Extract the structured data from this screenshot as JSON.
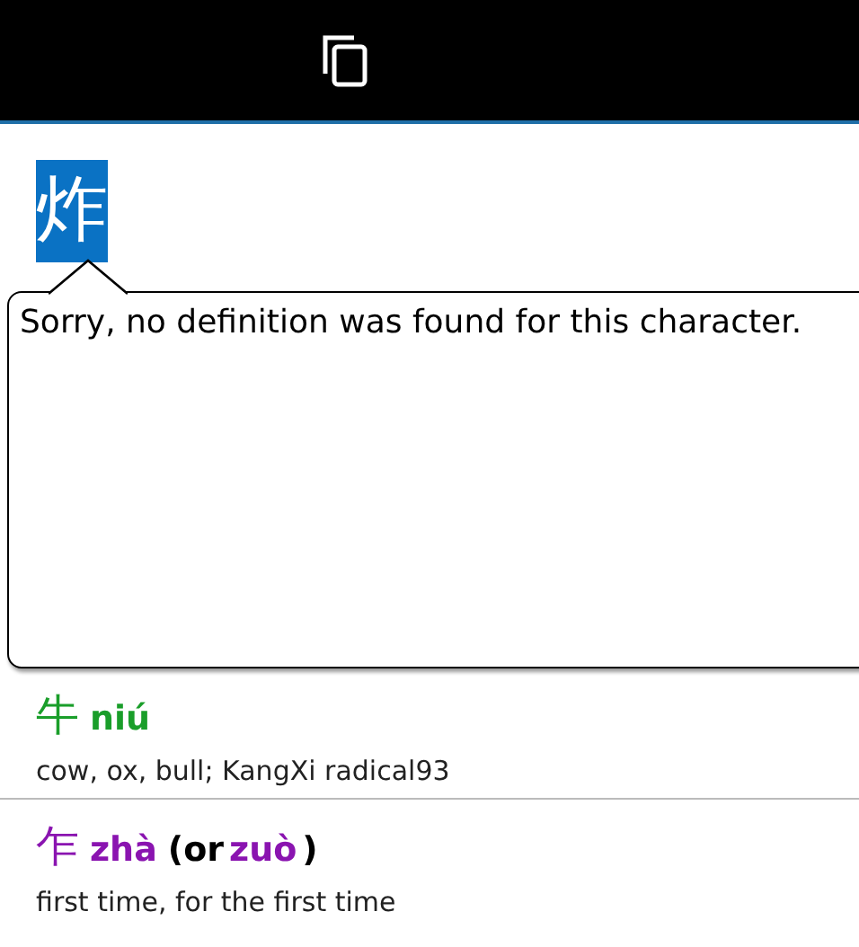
{
  "character": "炸",
  "popup": {
    "message": "Sorry, no definition was found for this character."
  },
  "entries": [
    {
      "character": "牛",
      "color": "#1a9e2a",
      "pinyin": "niú",
      "definition": "cow, ox, bull; KangXi radical93"
    },
    {
      "character": "乍",
      "color": "#8a14b0",
      "pinyin": "zhà",
      "alternate": {
        "open": "(or",
        "pinyin": "zuò",
        "close": ")"
      },
      "definition": "first time, for the first time"
    }
  ]
}
